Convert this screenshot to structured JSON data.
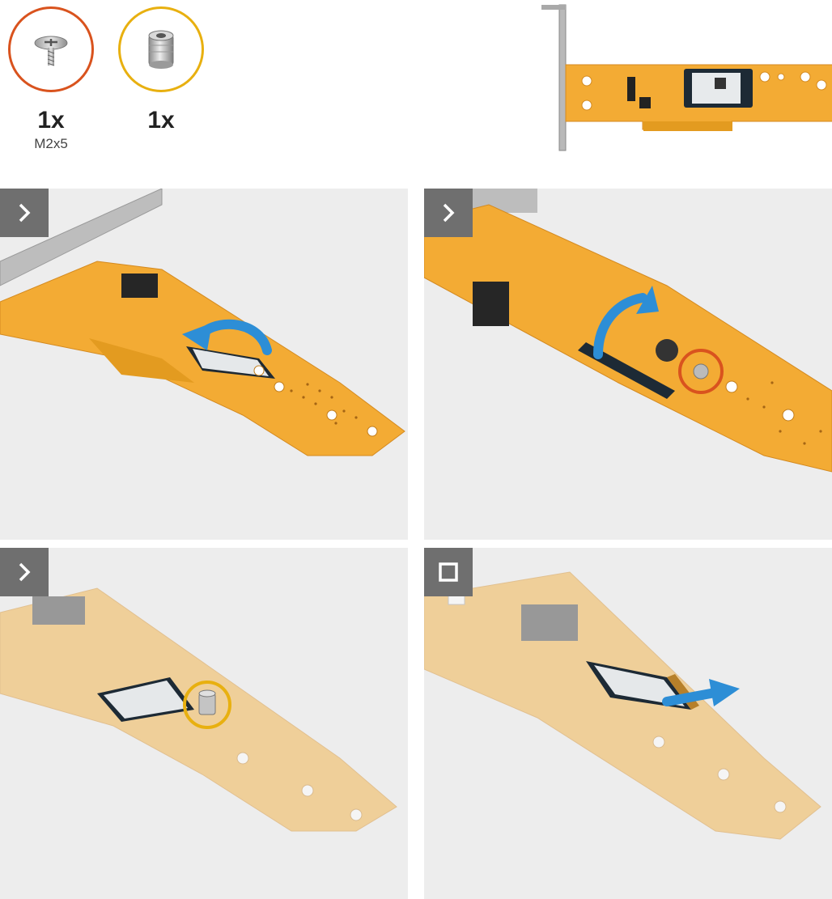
{
  "parts": [
    {
      "icon": "screw-icon",
      "quantity": "1x",
      "spec": "M2x5",
      "ring_color": "#d9531e"
    },
    {
      "icon": "standoff-icon",
      "quantity": "1x",
      "spec": "",
      "ring_color": "#e8b010"
    }
  ],
  "steps": [
    {
      "marker": "next-step-icon",
      "arrow_color": "#2d8ed6",
      "callout": "curved-arrow"
    },
    {
      "marker": "next-step-icon",
      "arrow_color": "#2d8ed6",
      "callout": "screw-highlight",
      "highlight_color": "#d9531e"
    },
    {
      "marker": "next-step-icon",
      "callout": "standoff-highlight",
      "highlight_color": "#e8b010"
    },
    {
      "marker": "stop-step-icon",
      "arrow_color": "#2d8ed6",
      "callout": "slide-arrow"
    }
  ],
  "colors": {
    "pcb": "#f3ab34",
    "pcb_dark": "#d48a20",
    "background": "#ededed",
    "badge": "#6f6f6f",
    "arrow": "#2d8ed6"
  }
}
